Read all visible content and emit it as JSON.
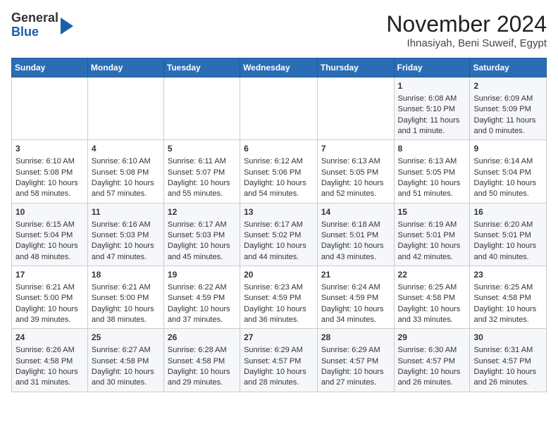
{
  "header": {
    "logo": {
      "line1": "General",
      "line2": "Blue"
    },
    "title": "November 2024",
    "subtitle": "Ihnasiyah, Beni Suweif, Egypt"
  },
  "calendar": {
    "weekdays": [
      "Sunday",
      "Monday",
      "Tuesday",
      "Wednesday",
      "Thursday",
      "Friday",
      "Saturday"
    ],
    "weeks": [
      [
        {
          "day": "",
          "content": ""
        },
        {
          "day": "",
          "content": ""
        },
        {
          "day": "",
          "content": ""
        },
        {
          "day": "",
          "content": ""
        },
        {
          "day": "",
          "content": ""
        },
        {
          "day": "1",
          "content": "Sunrise: 6:08 AM\nSunset: 5:10 PM\nDaylight: 11 hours and 1 minute."
        },
        {
          "day": "2",
          "content": "Sunrise: 6:09 AM\nSunset: 5:09 PM\nDaylight: 11 hours and 0 minutes."
        }
      ],
      [
        {
          "day": "3",
          "content": "Sunrise: 6:10 AM\nSunset: 5:08 PM\nDaylight: 10 hours and 58 minutes."
        },
        {
          "day": "4",
          "content": "Sunrise: 6:10 AM\nSunset: 5:08 PM\nDaylight: 10 hours and 57 minutes."
        },
        {
          "day": "5",
          "content": "Sunrise: 6:11 AM\nSunset: 5:07 PM\nDaylight: 10 hours and 55 minutes."
        },
        {
          "day": "6",
          "content": "Sunrise: 6:12 AM\nSunset: 5:06 PM\nDaylight: 10 hours and 54 minutes."
        },
        {
          "day": "7",
          "content": "Sunrise: 6:13 AM\nSunset: 5:05 PM\nDaylight: 10 hours and 52 minutes."
        },
        {
          "day": "8",
          "content": "Sunrise: 6:13 AM\nSunset: 5:05 PM\nDaylight: 10 hours and 51 minutes."
        },
        {
          "day": "9",
          "content": "Sunrise: 6:14 AM\nSunset: 5:04 PM\nDaylight: 10 hours and 50 minutes."
        }
      ],
      [
        {
          "day": "10",
          "content": "Sunrise: 6:15 AM\nSunset: 5:04 PM\nDaylight: 10 hours and 48 minutes."
        },
        {
          "day": "11",
          "content": "Sunrise: 6:16 AM\nSunset: 5:03 PM\nDaylight: 10 hours and 47 minutes."
        },
        {
          "day": "12",
          "content": "Sunrise: 6:17 AM\nSunset: 5:03 PM\nDaylight: 10 hours and 45 minutes."
        },
        {
          "day": "13",
          "content": "Sunrise: 6:17 AM\nSunset: 5:02 PM\nDaylight: 10 hours and 44 minutes."
        },
        {
          "day": "14",
          "content": "Sunrise: 6:18 AM\nSunset: 5:01 PM\nDaylight: 10 hours and 43 minutes."
        },
        {
          "day": "15",
          "content": "Sunrise: 6:19 AM\nSunset: 5:01 PM\nDaylight: 10 hours and 42 minutes."
        },
        {
          "day": "16",
          "content": "Sunrise: 6:20 AM\nSunset: 5:01 PM\nDaylight: 10 hours and 40 minutes."
        }
      ],
      [
        {
          "day": "17",
          "content": "Sunrise: 6:21 AM\nSunset: 5:00 PM\nDaylight: 10 hours and 39 minutes."
        },
        {
          "day": "18",
          "content": "Sunrise: 6:21 AM\nSunset: 5:00 PM\nDaylight: 10 hours and 38 minutes."
        },
        {
          "day": "19",
          "content": "Sunrise: 6:22 AM\nSunset: 4:59 PM\nDaylight: 10 hours and 37 minutes."
        },
        {
          "day": "20",
          "content": "Sunrise: 6:23 AM\nSunset: 4:59 PM\nDaylight: 10 hours and 36 minutes."
        },
        {
          "day": "21",
          "content": "Sunrise: 6:24 AM\nSunset: 4:59 PM\nDaylight: 10 hours and 34 minutes."
        },
        {
          "day": "22",
          "content": "Sunrise: 6:25 AM\nSunset: 4:58 PM\nDaylight: 10 hours and 33 minutes."
        },
        {
          "day": "23",
          "content": "Sunrise: 6:25 AM\nSunset: 4:58 PM\nDaylight: 10 hours and 32 minutes."
        }
      ],
      [
        {
          "day": "24",
          "content": "Sunrise: 6:26 AM\nSunset: 4:58 PM\nDaylight: 10 hours and 31 minutes."
        },
        {
          "day": "25",
          "content": "Sunrise: 6:27 AM\nSunset: 4:58 PM\nDaylight: 10 hours and 30 minutes."
        },
        {
          "day": "26",
          "content": "Sunrise: 6:28 AM\nSunset: 4:58 PM\nDaylight: 10 hours and 29 minutes."
        },
        {
          "day": "27",
          "content": "Sunrise: 6:29 AM\nSunset: 4:57 PM\nDaylight: 10 hours and 28 minutes."
        },
        {
          "day": "28",
          "content": "Sunrise: 6:29 AM\nSunset: 4:57 PM\nDaylight: 10 hours and 27 minutes."
        },
        {
          "day": "29",
          "content": "Sunrise: 6:30 AM\nSunset: 4:57 PM\nDaylight: 10 hours and 26 minutes."
        },
        {
          "day": "30",
          "content": "Sunrise: 6:31 AM\nSunset: 4:57 PM\nDaylight: 10 hours and 26 minutes."
        }
      ]
    ]
  }
}
